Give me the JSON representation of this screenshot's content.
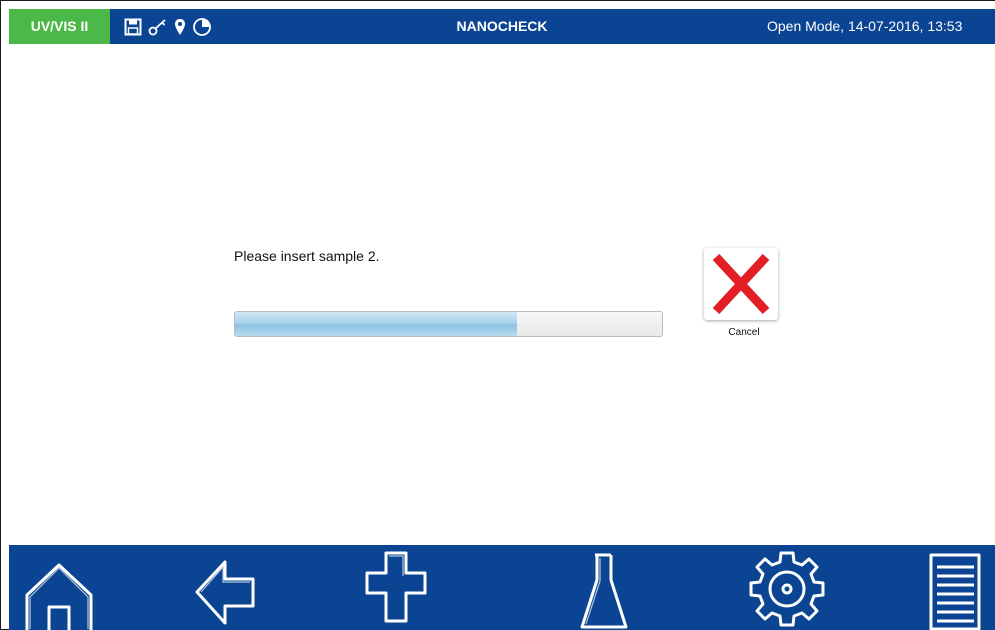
{
  "topbar": {
    "device_badge": "UV/VIS II",
    "app_title": "NANOCHECK",
    "mode_datetime": "Open Mode, 14-07-2016, 13:53",
    "status_icons": [
      "save-icon",
      "key-icon",
      "location-pin-icon",
      "pie-clock-icon"
    ],
    "badge_color": "#4cb848",
    "bar_color": "#0b4492"
  },
  "main": {
    "prompt": "Please insert sample 2.",
    "progress_fraction": 0.66,
    "cancel_label": "Cancel",
    "cancel_icon": "red-x-icon",
    "cancel_icon_color": "#e31e24"
  },
  "navbar": {
    "items": [
      "home-icon",
      "back-arrow-icon",
      "add-icon",
      "flask-icon",
      "settings-gear-icon",
      "list-menu-icon"
    ],
    "color": "#0b4492"
  }
}
